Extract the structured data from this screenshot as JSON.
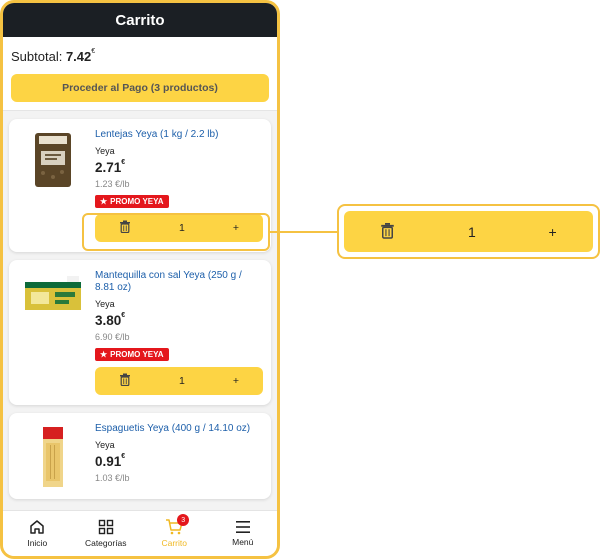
{
  "header": {
    "title": "Carrito"
  },
  "summary": {
    "subtotal_label": "Subtotal: ",
    "subtotal_value": "7.42",
    "currency": "€",
    "checkout_label": "Proceder al Pago (3 productos)"
  },
  "items": [
    {
      "name": "Lentejas Yeya (1 kg / 2.2 lb)",
      "brand": "Yeya",
      "price": "2.71",
      "currency": "€",
      "unit_price": "1.23 €/lb",
      "promo": "PROMO YEYA",
      "quantity": "1",
      "plus": "+"
    },
    {
      "name": "Mantequilla con sal Yeya (250 g / 8.81 oz)",
      "brand": "Yeya",
      "price": "3.80",
      "currency": "€",
      "unit_price": "6.90 €/lb",
      "promo": "PROMO YEYA",
      "quantity": "1",
      "plus": "+"
    },
    {
      "name": "Espaguetis Yeya (400 g / 14.10 oz)",
      "brand": "Yeya",
      "price": "0.91",
      "currency": "€",
      "unit_price": "1.03 €/lb"
    }
  ],
  "zoom": {
    "quantity": "1",
    "plus": "+"
  },
  "tabbar": {
    "home": "Inicio",
    "categories": "Categorías",
    "cart": "Carrito",
    "cart_badge": "3",
    "menu": "Menú"
  },
  "colors": {
    "accent": "#fdd444",
    "border_highlight": "#f5c242",
    "promo_red": "#e4171c",
    "link_blue": "#1d5faa",
    "header_dark": "#1b1f24"
  }
}
